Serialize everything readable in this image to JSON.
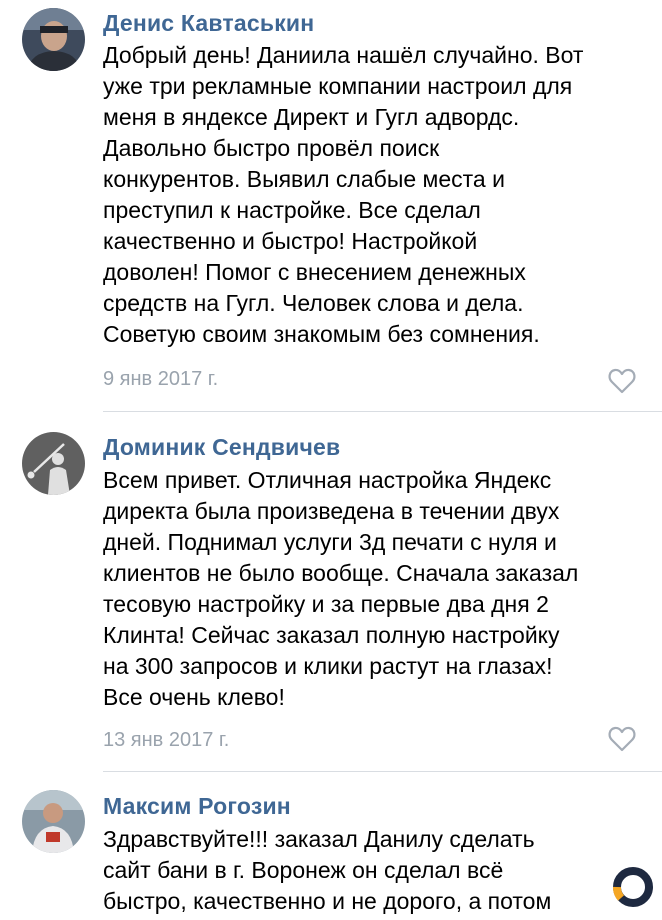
{
  "comments": [
    {
      "author": "Денис Кавтаськин",
      "lines": [
        "Добрый день! Даниила нашёл случайно. Вот",
        "уже три рекламные компании настроил для",
        "меня в яндексе Директ и Гугл адвордс.",
        "Давольно быстро провёл поиск",
        "конкурентов. Выявил слабые места и",
        "преступил к настройке. Все сделал",
        "качественно и быстро! Настройкой",
        "доволен! Помог с внесением денежных",
        "средств на Гугл. Человек слова и дела.",
        "Советую своим знакомым без сомнения."
      ],
      "date": "9 янв 2017 г.",
      "like_icon": "heart-outline-icon"
    },
    {
      "author": "Доминик Сендвичев",
      "lines": [
        "Всем привет. Отличная настройка Яндекс",
        "директа была произведена в течении двух",
        "дней. Поднимал услуги 3д печати с нуля и",
        "клиентов не было вообще. Сначала заказал",
        "тесовую настройку и за первые два дня 2",
        "Клинта! Сейчас заказал полную настройку",
        "на 300 запросов и клики растут на глазах!",
        "Все очень клево!"
      ],
      "date": "13 янв 2017 г.",
      "like_icon": "heart-outline-icon"
    },
    {
      "author": "Максим Рогозин",
      "lines": [
        "Здравствуйте!!! заказал Данилу сделать",
        "сайт бани в г. Воронеж он сделал всё",
        "быстро, качественно и не дорого, а потом"
      ]
    }
  ],
  "colors": {
    "author": "#3f6794",
    "date": "#9aa3ad",
    "divider": "#d9dde2",
    "logo_ring": "#1e2940",
    "logo_accent": "#f5a623"
  }
}
